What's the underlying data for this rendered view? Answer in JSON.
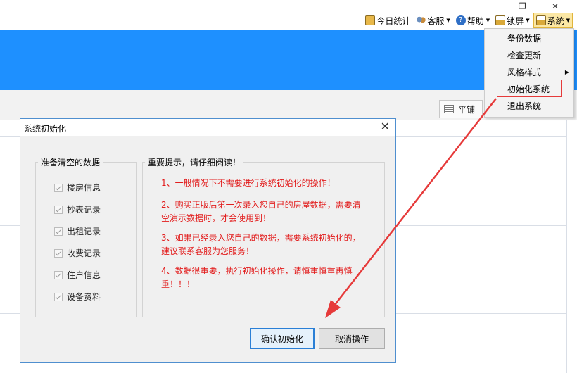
{
  "window": {
    "restore_glyph": "❐",
    "close_glyph": "✕"
  },
  "toolbar": {
    "today_stats": "今日统计",
    "service": "客服",
    "help": "帮助",
    "lock": "锁屏",
    "system": "系统"
  },
  "subbar": {
    "view_label": "平铺"
  },
  "menu": {
    "items": [
      "备份数据",
      "检查更新",
      "风格样式",
      "初始化系统",
      "退出系统"
    ],
    "submenu_glyph": "▶"
  },
  "dialog": {
    "title": "系统初始化",
    "close": "✕",
    "data_group": {
      "label": "准备清空的数据",
      "items": [
        "楼房信息",
        "抄表记录",
        "出租记录",
        "收费记录",
        "住户信息",
        "设备资料"
      ]
    },
    "tips_group": {
      "label": "重要提示，请仔细阅读！",
      "lines": [
        "1、一般情况下不需要进行系统初始化的操作！",
        "2、购买正版后第一次录入您自己的房屋数据，需要清",
        "空演示数据时，才会使用到！",
        "3、如果已经录入您自己的数据，需要系统初始化的，",
        "建议联系客服为您服务！",
        "4、数据很重要，执行初始化操作，请慎重慎重再慎",
        "重！！！"
      ]
    },
    "confirm_button": "确认初始化",
    "cancel_button": "取消操作"
  },
  "colors": {
    "banner": "#1e90ff",
    "tip_text": "#e21b1b",
    "annotation": "#e63a3a"
  },
  "icons": [
    "stats-icon",
    "service-icon",
    "help-icon",
    "lock-icon",
    "system-icon",
    "grid-icon",
    "checkbox-icon"
  ]
}
